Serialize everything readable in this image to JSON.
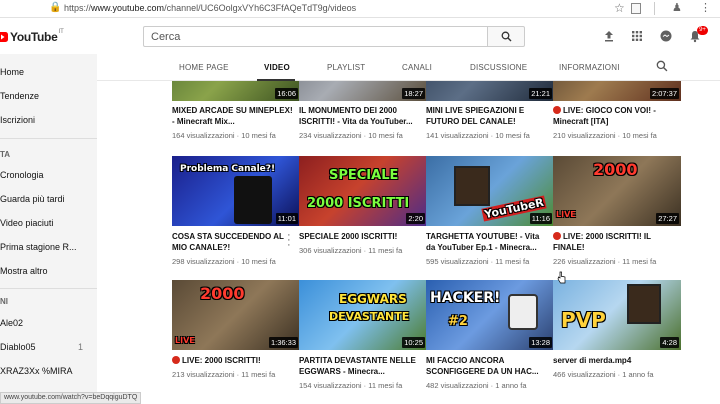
{
  "browser": {
    "url_prefix": "https://",
    "url_host": "www.youtube.com",
    "url_path": "/channel/UC6OolgxVYh6C3FfAQeTdT9g/videos",
    "status_url": "www.youtube.com/watch?v=beDqqiguDTQ"
  },
  "masthead": {
    "logo_text": "YouTube",
    "logo_country": "IT",
    "search_placeholder": "Cerca",
    "notification_count": "9+"
  },
  "sidebar": {
    "items": [
      {
        "label": "Home"
      },
      {
        "label": "Tendenze"
      },
      {
        "label": "Iscrizioni"
      }
    ],
    "section_library": "TA",
    "library_items": [
      {
        "label": "Cronologia"
      },
      {
        "label": "Guarda più tardi"
      },
      {
        "label": "Video piaciuti"
      },
      {
        "label": "Prima stagione R..."
      },
      {
        "label": "Mostra altro"
      }
    ],
    "section_subs": "NI",
    "subs": [
      {
        "label": "Ale02",
        "count": ""
      },
      {
        "label": "Diablo05",
        "count": "1"
      },
      {
        "label": "XRAZ3Xx %MIRA",
        "count": ""
      }
    ]
  },
  "tabs": [
    {
      "label": "HOME PAGE",
      "active": false
    },
    {
      "label": "VIDEO",
      "active": true
    },
    {
      "label": "PLAYLIST",
      "active": false
    },
    {
      "label": "CANALI",
      "active": false
    },
    {
      "label": "DISCUSSIONE",
      "active": false
    },
    {
      "label": "INFORMAZIONI",
      "active": false
    }
  ],
  "rows": [
    [
      {
        "title": "MIXED ARCADE SU MINEPLEX! - Minecraft Mix...",
        "views": "164 visualizzazioni",
        "age": "10 mesi fa",
        "duration": "16:06",
        "live": false
      },
      {
        "title": "IL MONUMENTO DEI 2000 ISCRITTI! - Vita da YouTuber...",
        "views": "234 visualizzazioni",
        "age": "10 mesi fa",
        "duration": "18:27",
        "live": false
      },
      {
        "title": "MINI LIVE SPIEGAZIONI E FUTURO DEL CANALE!",
        "views": "141 visualizzazioni",
        "age": "10 mesi fa",
        "duration": "21:21",
        "live": false
      },
      {
        "title": "LIVE: GIOCO CON VOI! - Minecraft [ITA]",
        "views": "210 visualizzazioni",
        "age": "10 mesi fa",
        "duration": "2:07:37",
        "live": true
      }
    ],
    [
      {
        "title": "COSA STA SUCCEDENDO AL MIO CANALE?!",
        "views": "298 visualizzazioni",
        "age": "10 mesi fa",
        "duration": "11:01",
        "live": false,
        "thumb_text": "Problema Canale?!"
      },
      {
        "title": "SPECIALE 2000 ISCRITTI!",
        "views": "306 visualizzazioni",
        "age": "11 mesi fa",
        "duration": "2:20",
        "live": false,
        "thumb_text": "SPECIALE",
        "thumb_text2": "2000 ISCRITTI"
      },
      {
        "title": "TARGHETTA YOUTUBE! - Vita da YouTuber Ep.1 - Minecra...",
        "views": "595 visualizzazioni",
        "age": "11 mesi fa",
        "duration": "11:16",
        "live": false,
        "thumb_text": "YouTubeR"
      },
      {
        "title": "LIVE: 2000 ISCRITTI! IL FINALE!",
        "views": "226 visualizzazioni",
        "age": "11 mesi fa",
        "duration": "27:27",
        "live": true,
        "thumb_text": "2000",
        "thumb_text2": "LIVE"
      }
    ],
    [
      {
        "title": "LIVE: 2000 ISCRITTI!",
        "views": "213 visualizzazioni",
        "age": "11 mesi fa",
        "duration": "1:36:33",
        "live": true,
        "thumb_text": "2000",
        "thumb_text2": "LIVE"
      },
      {
        "title": "PARTITA DEVASTANTE NELLE EGGWARS - Minecra...",
        "views": "154 visualizzazioni",
        "age": "11 mesi fa",
        "duration": "10:25",
        "live": false,
        "thumb_text": "EGGWARS",
        "thumb_text2": "DEVASTANTE"
      },
      {
        "title": "MI FACCIO ANCORA SCONFIGGERE DA UN HAC...",
        "views": "482 visualizzazioni",
        "age": "1 anno fa",
        "duration": "13:28",
        "live": false,
        "thumb_text": "HACKER!",
        "thumb_text2": "#2"
      },
      {
        "title": "server di merda.mp4",
        "views": "466 visualizzazioni",
        "age": "1 anno fa",
        "duration": "4:28",
        "live": false,
        "thumb_text": "PVP"
      }
    ]
  ],
  "colors": {
    "youtube_red": "#ff0000",
    "live_dot": "#d62a1b"
  }
}
